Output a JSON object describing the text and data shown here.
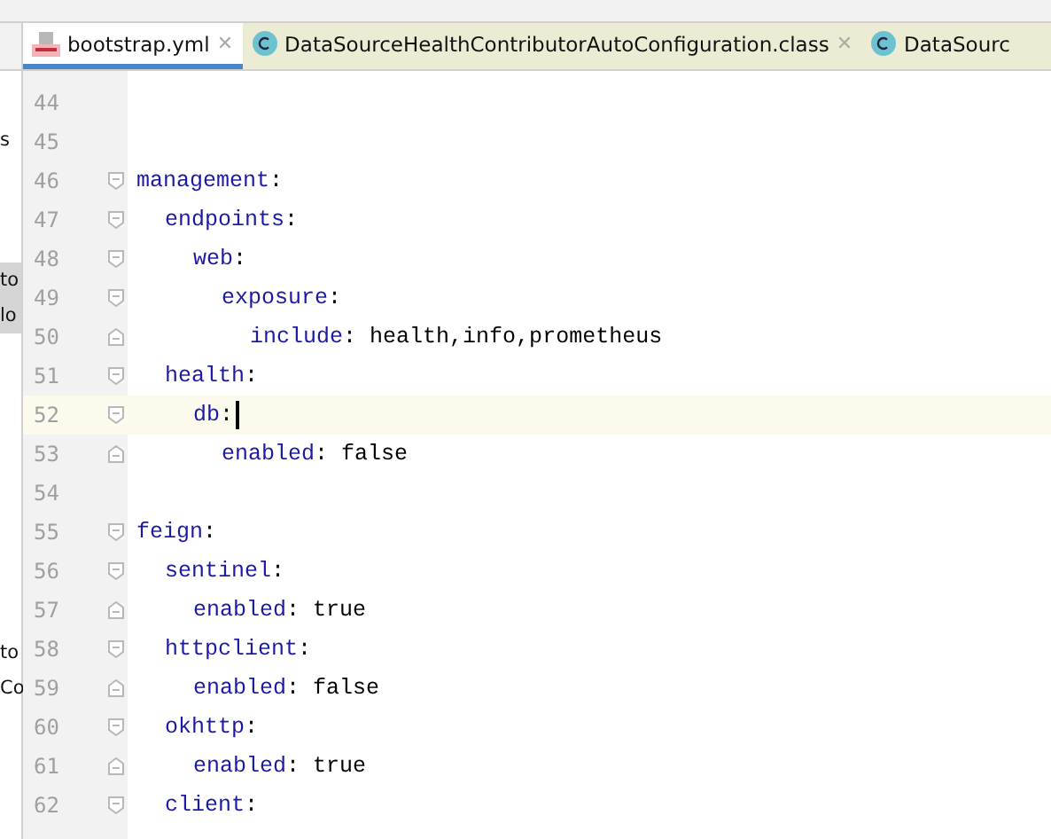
{
  "tabs": [
    {
      "kind": "yml",
      "label": "bootstrap.yml",
      "selected": true,
      "close": "✕"
    },
    {
      "kind": "class",
      "label": "DataSourceHealthContributorAutoConfiguration.class",
      "selected": false,
      "close": "✕"
    },
    {
      "kind": "class",
      "label": "DataSourc",
      "selected": false
    }
  ],
  "side_panel": {
    "items": [
      {
        "label": "s",
        "selected": false
      },
      {
        "label": "to",
        "selected": true
      },
      {
        "label": "lo",
        "selected": true
      },
      {
        "label": "to",
        "selected": false
      },
      {
        "label": "Co",
        "selected": false
      }
    ]
  },
  "editor": {
    "lines": [
      {
        "number": "44",
        "current": false
      },
      {
        "number": "45",
        "current": false
      },
      {
        "number": "46",
        "key": "management:",
        "current": false,
        "expanded": true,
        "children": [
          {
            "number": "47",
            "key": "endpoints:",
            "current": false,
            "expanded": true,
            "children": [
              {
                "number": "48",
                "key": "web:",
                "current": false,
                "expanded": true,
                "children": [
                  {
                    "number": "49",
                    "key": "exposure:",
                    "current": false,
                    "expanded": true,
                    "children": [
                      {
                        "number": "50",
                        "key": "include:",
                        "value": "health,info,prometheus",
                        "current": false
                      }
                    ]
                  }
                ]
              }
            ]
          },
          {
            "number": "51",
            "key": "health:",
            "current": false,
            "expanded": true,
            "children": [
              {
                "number": "52",
                "key": "db:",
                "current": true,
                "expanded": true,
                "children": [
                  {
                    "number": "53",
                    "key": "enabled:",
                    "value": "false",
                    "current": false
                  }
                ]
              }
            ]
          }
        ]
      },
      {
        "number": "54",
        "current": false
      },
      {
        "number": "55",
        "key": "feign:",
        "current": false,
        "expanded": true,
        "children": [
          {
            "number": "56",
            "key": "sentinel:",
            "current": false,
            "expanded": true,
            "children": [
              {
                "number": "57",
                "key": "enabled:",
                "value": "true",
                "current": false
              }
            ]
          },
          {
            "number": "58",
            "key": "httpclient:",
            "current": false,
            "expanded": true,
            "children": [
              {
                "number": "59",
                "key": "enabled:",
                "value": "false",
                "current": false
              }
            ]
          },
          {
            "number": "60",
            "key": "okhttp:",
            "current": false,
            "expanded": true,
            "children": [
              {
                "number": "61",
                "key": "enabled:",
                "value": "true",
                "current": false
              }
            ]
          },
          {
            "number": "62",
            "key": "client:",
            "current": false,
            "expanded": true
          }
        ]
      }
    ]
  }
}
